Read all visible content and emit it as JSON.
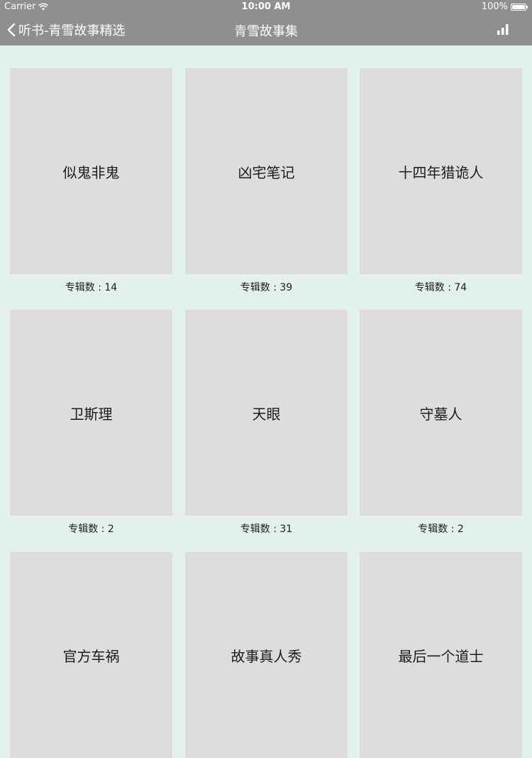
{
  "status_bar": {
    "carrier": "Carrier",
    "time": "10:00 AM",
    "battery": "100%"
  },
  "nav": {
    "back_label": "听书-青雪故事精选",
    "title": "青雪故事集"
  },
  "count_prefix": "专辑数 : ",
  "books": [
    {
      "title": "似鬼非鬼",
      "count": "专辑数 : 14"
    },
    {
      "title": "凶宅笔记",
      "count": "专辑数 : 39"
    },
    {
      "title": "十四年猎诡人",
      "count": "专辑数 : 74"
    },
    {
      "title": "卫斯理",
      "count": "专辑数 : 2"
    },
    {
      "title": "天眼",
      "count": "专辑数 : 31"
    },
    {
      "title": "守墓人",
      "count": "专辑数 : 2"
    },
    {
      "title": "官方车祸",
      "count": ""
    },
    {
      "title": "故事真人秀",
      "count": ""
    },
    {
      "title": "最后一个道士",
      "count": ""
    }
  ]
}
